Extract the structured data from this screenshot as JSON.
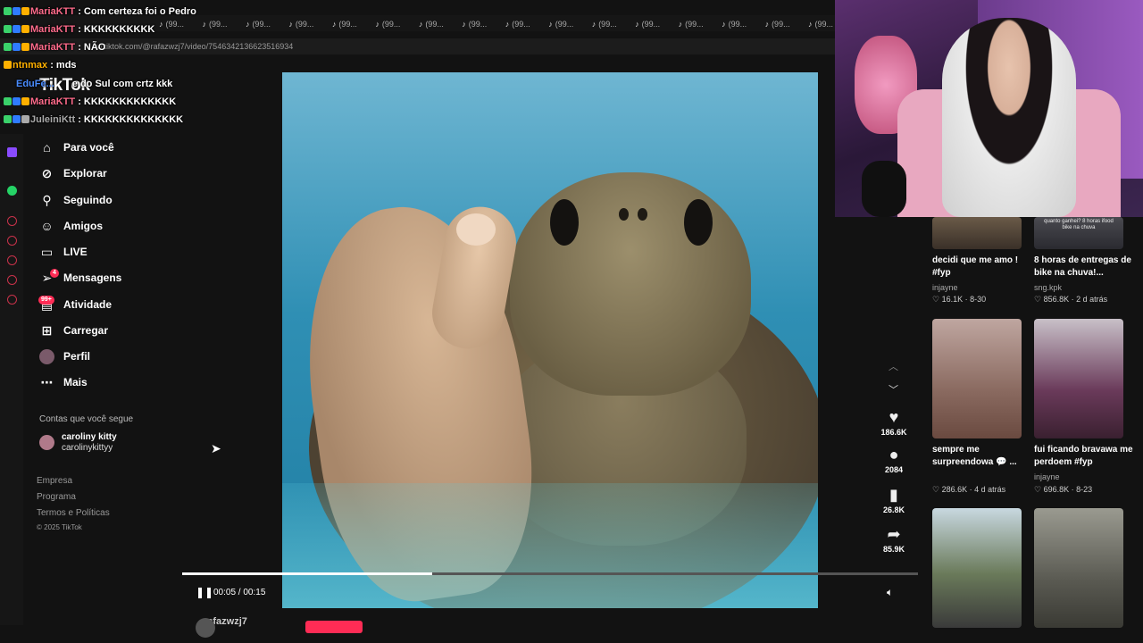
{
  "browser": {
    "bookmark_label": "(99...",
    "url": "w.tiktok.com/@rafazwzj7/video/7546342136623516934"
  },
  "chat": [
    {
      "user": "MariaKTT",
      "msg": ": Com certeza foi o Pedro"
    },
    {
      "user": "MariaKTT",
      "msg": ": KKKKKKKKKK"
    },
    {
      "user": "MariaKTT",
      "msg": ": NÃO"
    },
    {
      "user": "ntnmax",
      "msg": ": mds"
    },
    {
      "user": "EduFe...",
      "msg": "e do Sul com crtz kkk"
    },
    {
      "user": "MariaKTT",
      "msg": ": KKKKKKKKKKKKK"
    },
    {
      "user": "JuleiniKtt",
      "msg": ": KKKKKKKKKKKKKK"
    }
  ],
  "sidebar": {
    "logo": "TikTok",
    "items": [
      {
        "label": "Para você",
        "icon": "home-icon"
      },
      {
        "label": "Explorar",
        "icon": "compass-icon"
      },
      {
        "label": "Seguindo",
        "icon": "following-icon"
      },
      {
        "label": "Amigos",
        "icon": "friends-icon"
      },
      {
        "label": "LIVE",
        "icon": "live-icon"
      },
      {
        "label": "Mensagens",
        "icon": "messages-icon",
        "badge": "4"
      },
      {
        "label": "Atividade",
        "icon": "activity-icon",
        "badge": "99+"
      },
      {
        "label": "Carregar",
        "icon": "upload-icon"
      },
      {
        "label": "Perfil",
        "icon": "avatar"
      },
      {
        "label": "Mais",
        "icon": "more-icon"
      }
    ],
    "following_title": "Contas que você segue",
    "following": [
      {
        "name": "caroliny kitty",
        "handle": "carolinykittyy"
      }
    ],
    "footer": [
      "Empresa",
      "Programa",
      "Termos e Políticas",
      "© 2025 TikTok"
    ]
  },
  "player": {
    "time": "00:05 / 00:15",
    "progress": 0.34,
    "author": "rafazwzj7"
  },
  "actions": [
    {
      "icon": "heart-icon",
      "count": "186.6K"
    },
    {
      "icon": "comment-icon",
      "count": "2084"
    },
    {
      "icon": "bookmark-icon",
      "count": "26.8K"
    },
    {
      "icon": "share-icon",
      "count": "85.9K"
    }
  ],
  "recommended": [
    {
      "title": "decidi que me amo ! #fyp",
      "author": "injayne",
      "likes": "16.1K",
      "date": "8-30"
    },
    {
      "title": "8 horas de entregas de bike na chuva!...",
      "author": "sng.kpk",
      "likes": "856.8K",
      "date": "2 d atrás",
      "overlay": "quanto ganhei? 8 horas ifood bike na chuva"
    },
    {
      "title": "sempre me surpreendowa 💬 ...",
      "author": "injayne",
      "likes": "286.6K",
      "date": "4 d atrás"
    },
    {
      "title": "fui ficando bravawa me perdoem #fyp",
      "author": "injayne",
      "likes": "696.8K",
      "date": "8-23"
    },
    {
      "title": "",
      "author": "",
      "likes": "",
      "date": ""
    },
    {
      "title": "",
      "author": "",
      "likes": "",
      "date": ""
    }
  ]
}
